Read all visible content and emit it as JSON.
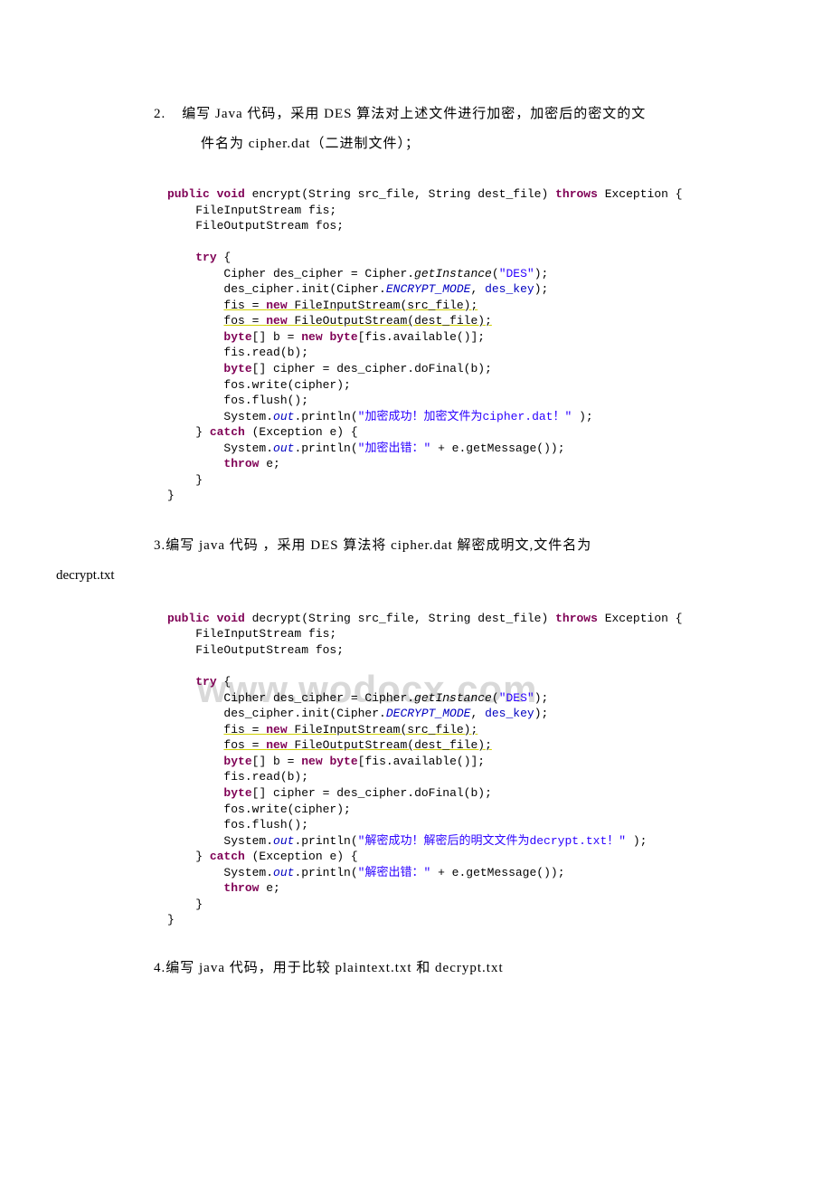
{
  "watermark": "www.wodocx.com",
  "section2": {
    "num": "2.",
    "line1": "编写 Java 代码，采用 DES 算法对上述文件进行加密，加密后的密文的文",
    "line2": "件名为 cipher.dat（二进制文件）；"
  },
  "code1": {
    "sig1": "public void",
    "sig2": " encrypt(String src_file, String dest_file) ",
    "sig3": "throws",
    "sig4": " Exception {",
    "l1": "    FileInputStream fis;",
    "l2": "    FileOutputStream fos;",
    "l3": "",
    "l4a": "    ",
    "l4b": "try",
    "l4c": " {",
    "l5a": "        Cipher des_cipher = Cipher.",
    "l5b": "getInstance",
    "l5c": "(",
    "l5d": "\"DES\"",
    "l5e": ");",
    "l6a": "        des_cipher.init(Cipher.",
    "l6b": "ENCRYPT_MODE",
    "l6c": ", ",
    "l6d": "des_key",
    "l6e": ");",
    "l7a": "        ",
    "l7b": "fis = ",
    "l7c": "new",
    "l7d": " FileInputStream(src_file);",
    "l8a": "        ",
    "l8b": "fos = ",
    "l8c": "new",
    "l8d": " FileOutputStream(dest_file);",
    "l9a": "        ",
    "l9b": "byte",
    "l9c": "[] b = ",
    "l9d": "new byte",
    "l9e": "[fis.available()];",
    "l10": "        fis.read(b);",
    "l11a": "        ",
    "l11b": "byte",
    "l11c": "[] cipher = des_cipher.doFinal(b);",
    "l12": "        fos.write(cipher);",
    "l13": "        fos.flush();",
    "l14a": "        System.",
    "l14b": "out",
    "l14c": ".println(",
    "l14d": "\"加密成功！加密文件为cipher.dat！\"",
    "l14e": " );",
    "l15a": "    } ",
    "l15b": "catch",
    "l15c": " (Exception e) {",
    "l16a": "        System.",
    "l16b": "out",
    "l16c": ".println(",
    "l16d": "\"加密出错：\"",
    "l16e": " + e.getMessage());",
    "l17a": "        ",
    "l17b": "throw",
    "l17c": " e;",
    "l18": "    }",
    "l19": "}"
  },
  "section3": {
    "num3": "3.",
    "text": "编写 java 代码 ，采用 DES 算法将 cipher.dat 解密成明文,文件名为",
    "decrypt": "decrypt.txt"
  },
  "code2": {
    "sig1": "public void",
    "sig2": " decrypt(String src_file, String dest_file) ",
    "sig3": "throws",
    "sig4": " Exception {",
    "l1": "    FileInputStream fis;",
    "l2": "    FileOutputStream fos;",
    "l3": "",
    "l4a": "    ",
    "l4b": "try",
    "l4c": " {",
    "l5a": "        Cipher des_cipher = Cipher.",
    "l5b": "getInstance",
    "l5c": "(",
    "l5d": "\"DES\"",
    "l5e": ");",
    "l6a": "        des_cipher.init(Cipher.",
    "l6b": "DECRYPT_MODE",
    "l6c": ", ",
    "l6d": "des_key",
    "l6e": ");",
    "l7a": "        ",
    "l7b": "fis = ",
    "l7c": "new",
    "l7d": " FileInputStream(src_file);",
    "l8a": "        ",
    "l8b": "fos = ",
    "l8c": "new",
    "l8d": " FileOutputStream(dest_file);",
    "l9a": "        ",
    "l9b": "byte",
    "l9c": "[] b = ",
    "l9d": "new byte",
    "l9e": "[fis.available()];",
    "l10": "        fis.read(b);",
    "l11a": "        ",
    "l11b": "byte",
    "l11c": "[] cipher = des_cipher.doFinal(b);",
    "l12": "        fos.write(cipher);",
    "l13": "        fos.flush();",
    "l14a": "        System.",
    "l14b": "out",
    "l14c": ".println(",
    "l14d": "\"解密成功！解密后的明文文件为decrypt.txt！\"",
    "l14e": " );",
    "l15a": "    } ",
    "l15b": "catch",
    "l15c": " (Exception e) {",
    "l16a": "        System.",
    "l16b": "out",
    "l16c": ".println(",
    "l16d": "\"解密出错：\"",
    "l16e": " + e.getMessage());",
    "l17a": "        ",
    "l17b": "throw",
    "l17c": " e;",
    "l18": "    }",
    "l19": "}"
  },
  "section4": {
    "num4": "4.",
    "text": "编写 java 代码，用于比较 plaintext.txt 和 decrypt.txt"
  }
}
